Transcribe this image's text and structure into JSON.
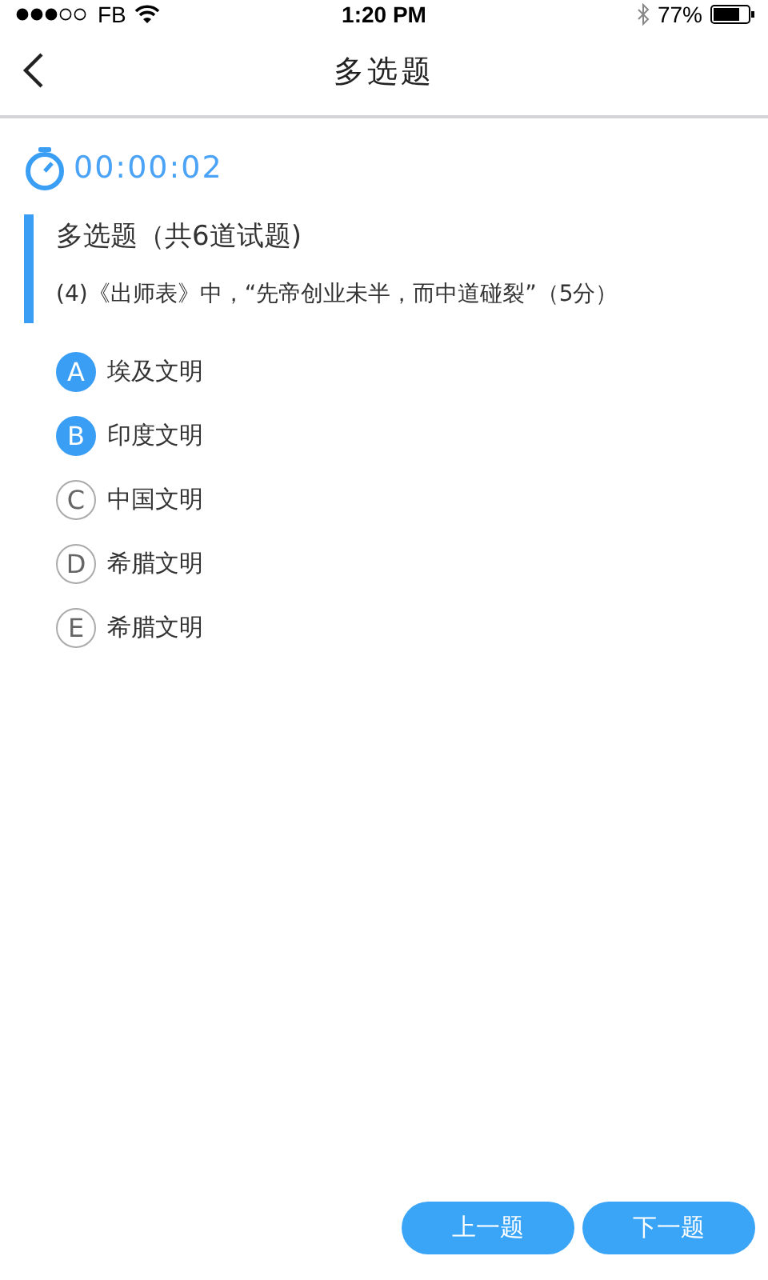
{
  "status_bar": {
    "carrier": "FB",
    "time": "1:20 PM",
    "battery": "77%"
  },
  "nav": {
    "title": "多选题"
  },
  "timer": "00:00:02",
  "section": {
    "heading": "多选题（共6道试题)",
    "question": "(4)《出师表》中，“先帝创业未半，而中道碰裂”（5分）"
  },
  "options": [
    {
      "letter": "A",
      "text": "埃及文明",
      "selected": true
    },
    {
      "letter": "B",
      "text": "印度文明",
      "selected": true
    },
    {
      "letter": "C",
      "text": "中国文明",
      "selected": false
    },
    {
      "letter": "D",
      "text": "希腊文明",
      "selected": false
    },
    {
      "letter": "E",
      "text": "希腊文明",
      "selected": false
    }
  ],
  "buttons": [
    "上一题",
    "下一题"
  ]
}
